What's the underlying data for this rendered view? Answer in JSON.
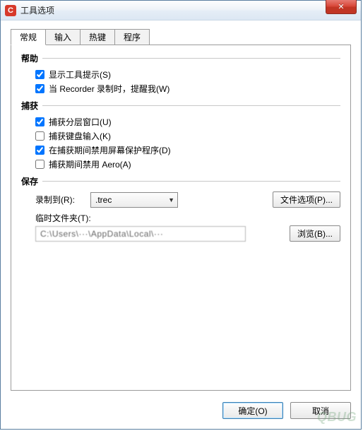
{
  "window": {
    "title": "工具选项",
    "close_glyph": "✕"
  },
  "tabs": {
    "t0": "常规",
    "t1": "输入",
    "t2": "热键",
    "t3": "程序",
    "active_index": 0
  },
  "sections": {
    "help": {
      "heading": "帮助",
      "show_tooltips": {
        "label": "显示工具提示(S)",
        "checked": true
      },
      "remind_recording": {
        "label": "当 Recorder 录制时，提醒我(W)",
        "checked": true
      }
    },
    "capture": {
      "heading": "捕获",
      "layered_windows": {
        "label": "捕获分层窗口(U)",
        "checked": true
      },
      "keyboard_input": {
        "label": "捕获键盘输入(K)",
        "checked": false
      },
      "disable_screensaver": {
        "label": "在捕获期间禁用屏幕保护程序(D)",
        "checked": true
      },
      "disable_aero": {
        "label": "捕获期间禁用 Aero(A)",
        "checked": false
      }
    },
    "save": {
      "heading": "保存",
      "record_to_label": "录制到(R):",
      "record_to_value": ".trec",
      "file_options_btn": "文件选项(P)...",
      "temp_folder_label": "临时文件夹(T):",
      "temp_folder_value": "C:\\Users\\···\\AppData\\Local\\···",
      "browse_btn": "浏览(B)..."
    }
  },
  "footer": {
    "ok": "确定(O)",
    "cancel": "取消"
  },
  "watermark": "QBUG"
}
